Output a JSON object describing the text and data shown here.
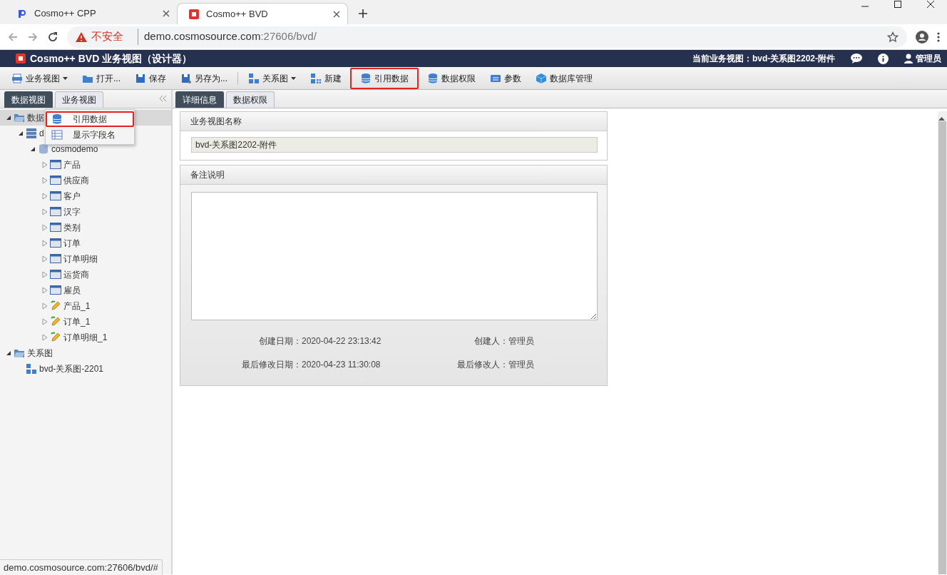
{
  "browser": {
    "tabs": [
      {
        "title": "Cosmo++ CPP",
        "selected": false
      },
      {
        "title": "Cosmo++ BVD",
        "selected": true
      }
    ],
    "security": "不安全",
    "url_host": "demo.cosmosource.com",
    "url_rest": ":27606/bvd/"
  },
  "header": {
    "title": "Cosmo++ BVD 业务视图（设计器）",
    "current_view": "当前业务视图：bvd-关系图2202-附件",
    "user": "管理员"
  },
  "toolbar": [
    {
      "label": "业务视图",
      "kind": "view",
      "dropdown": true,
      "highlighted": false
    },
    {
      "label": "打开...",
      "kind": "open",
      "dropdown": false,
      "highlighted": false
    },
    {
      "label": "保存",
      "kind": "save",
      "dropdown": false,
      "highlighted": false
    },
    {
      "label": "另存为...",
      "kind": "saveas",
      "dropdown": false,
      "highlighted": false
    },
    {
      "kind": "separator"
    },
    {
      "label": "关系图",
      "kind": "diagram",
      "dropdown": true,
      "highlighted": false
    },
    {
      "label": "新建",
      "kind": "new",
      "dropdown": false,
      "highlighted": false
    },
    {
      "label": "引用数据",
      "kind": "db",
      "dropdown": false,
      "highlighted": true
    },
    {
      "label": "数据权限",
      "kind": "db",
      "dropdown": false,
      "highlighted": false
    },
    {
      "label": "参数",
      "kind": "param",
      "dropdown": false,
      "highlighted": false
    },
    {
      "label": "数据库管理",
      "kind": "cube",
      "dropdown": false,
      "highlighted": false
    }
  ],
  "left_tabs": [
    {
      "label": "数据视图",
      "selected": true
    },
    {
      "label": "业务视图",
      "selected": false
    }
  ],
  "tree": [
    {
      "label": "数据",
      "kind": "folder",
      "expanded": true,
      "selected": true,
      "children": [
        {
          "label": "d",
          "kind": "server",
          "expanded": true,
          "selected": false,
          "children": [
            {
              "label": "cosmodemo",
              "kind": "database",
              "expanded": true,
              "selected": false,
              "children": [
                {
                  "label": "产品",
                  "kind": "table",
                  "expanded": false,
                  "selected": false
                },
                {
                  "label": "供应商",
                  "kind": "table",
                  "expanded": false,
                  "selected": false
                },
                {
                  "label": "客户",
                  "kind": "table",
                  "expanded": false,
                  "selected": false
                },
                {
                  "label": "汉字",
                  "kind": "table",
                  "expanded": false,
                  "selected": false
                },
                {
                  "label": "类别",
                  "kind": "table",
                  "expanded": false,
                  "selected": false
                },
                {
                  "label": "订单",
                  "kind": "table",
                  "expanded": false,
                  "selected": false
                },
                {
                  "label": "订单明细",
                  "kind": "table",
                  "expanded": false,
                  "selected": false
                },
                {
                  "label": "运货商",
                  "kind": "table",
                  "expanded": false,
                  "selected": false
                },
                {
                  "label": "雇员",
                  "kind": "table",
                  "expanded": false,
                  "selected": false
                },
                {
                  "label": "产品_1",
                  "kind": "edit",
                  "expanded": false,
                  "selected": false
                },
                {
                  "label": "订单_1",
                  "kind": "edit",
                  "expanded": false,
                  "selected": false
                },
                {
                  "label": "订单明细_1",
                  "kind": "edit",
                  "expanded": false,
                  "selected": false
                }
              ]
            }
          ]
        }
      ]
    },
    {
      "label": "关系图",
      "kind": "folder",
      "expanded": true,
      "selected": false,
      "children": [
        {
          "label": "bvd-关系图-2201",
          "kind": "diagram",
          "selected": false
        }
      ]
    }
  ],
  "context_menu": [
    {
      "label": "引用数据",
      "kind": "db",
      "highlighted": true
    },
    {
      "label": "显示字段名",
      "kind": "fields",
      "highlighted": false
    }
  ],
  "content_tabs": [
    {
      "label": "详细信息",
      "selected": true
    },
    {
      "label": "数据权限",
      "selected": false
    }
  ],
  "name_panel": {
    "title": "业务视图名称",
    "value": "bvd-关系图2202-附件"
  },
  "notes_panel": {
    "title": "备注说明",
    "meta": [
      {
        "label": "创建日期：",
        "value": "2020-04-22 23:13:42"
      },
      {
        "label": "创建人：",
        "value": "管理员"
      },
      {
        "label": "最后修改日期：",
        "value": "2020-04-23 11:30:08"
      },
      {
        "label": "最后修改人：",
        "value": "管理员"
      }
    ]
  },
  "status_url": "demo.cosmosource.com:27606/bvd/#"
}
